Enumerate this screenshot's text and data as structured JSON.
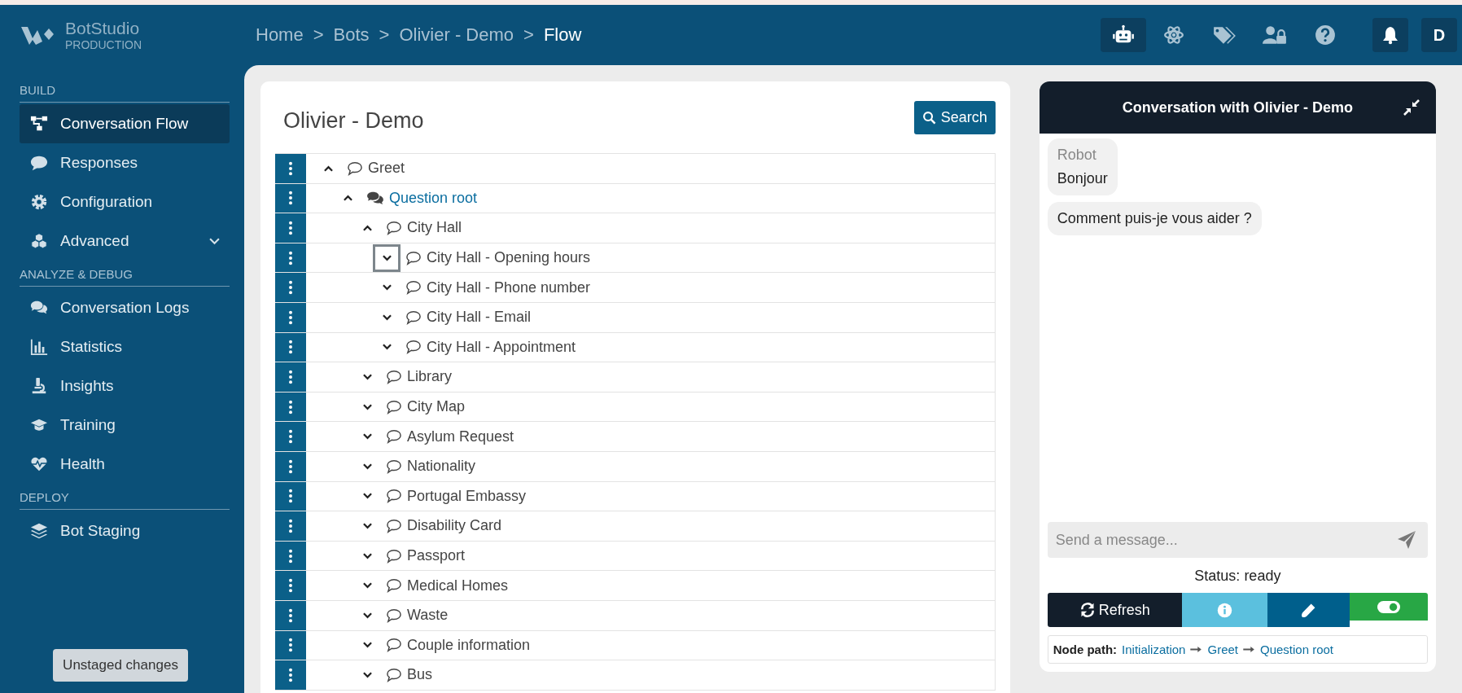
{
  "brand": {
    "name": "BotStudio",
    "environment": "PRODUCTION"
  },
  "breadcrumb": [
    {
      "label": "Home",
      "current": false
    },
    {
      "label": "Bots",
      "current": false
    },
    {
      "label": "Olivier - Demo",
      "current": false
    },
    {
      "label": "Flow",
      "current": true
    }
  ],
  "breadcrumb_separator": ">",
  "header_actions": [
    {
      "kind": "robot",
      "selected": true
    },
    {
      "kind": "atom",
      "selected": false
    },
    {
      "kind": "tags",
      "selected": false
    },
    {
      "kind": "user-lock",
      "selected": false
    },
    {
      "kind": "help",
      "selected": false
    }
  ],
  "notifications": {
    "kind": "bell"
  },
  "user": {
    "initial": "D"
  },
  "sidebar": {
    "sections": [
      {
        "title": "BUILD",
        "items": [
          {
            "label": "Conversation Flow",
            "kind": "flow",
            "selected": true
          },
          {
            "label": "Responses",
            "kind": "comment",
            "selected": false
          },
          {
            "label": "Configuration",
            "kind": "gear",
            "selected": false
          },
          {
            "label": "Advanced",
            "kind": "cubes",
            "selected": false,
            "expanded": false
          }
        ]
      },
      {
        "title": "ANALYZE & DEBUG",
        "items": [
          {
            "label": "Conversation Logs",
            "kind": "comments",
            "selected": false
          },
          {
            "label": "Statistics",
            "kind": "chart",
            "selected": false
          },
          {
            "label": "Insights",
            "kind": "microscope",
            "selected": false
          },
          {
            "label": "Training",
            "kind": "cap",
            "selected": false
          },
          {
            "label": "Health",
            "kind": "heart",
            "selected": false
          }
        ]
      },
      {
        "title": "DEPLOY",
        "items": [
          {
            "label": "Bot Staging",
            "kind": "layers",
            "selected": false
          }
        ]
      }
    ],
    "footer_button": "Unstaged changes"
  },
  "flow": {
    "title": "Olivier - Demo",
    "search_button": "Search",
    "tree": [
      {
        "label": "Greet",
        "kind": "message",
        "expanded": true,
        "focused": false,
        "children": [
          {
            "label": "Question root",
            "kind": "question",
            "expanded": true,
            "focused": false,
            "children": [
              {
                "label": "City Hall",
                "kind": "message",
                "expanded": true,
                "focused": false,
                "children": [
                  {
                    "label": "City Hall - Opening hours",
                    "kind": "message",
                    "expanded": false,
                    "focused": true
                  },
                  {
                    "label": "City Hall - Phone number",
                    "kind": "message",
                    "expanded": false,
                    "focused": false
                  },
                  {
                    "label": "City Hall - Email",
                    "kind": "message",
                    "expanded": false,
                    "focused": false
                  },
                  {
                    "label": "City Hall - Appointment",
                    "kind": "message",
                    "expanded": false,
                    "focused": false
                  }
                ]
              },
              {
                "label": "Library",
                "kind": "message",
                "expanded": false,
                "focused": false
              },
              {
                "label": "City Map",
                "kind": "message",
                "expanded": false,
                "focused": false
              },
              {
                "label": "Asylum Request",
                "kind": "message",
                "expanded": false,
                "focused": false
              },
              {
                "label": "Nationality",
                "kind": "message",
                "expanded": false,
                "focused": false
              },
              {
                "label": "Portugal Embassy",
                "kind": "message",
                "expanded": false,
                "focused": false
              },
              {
                "label": "Disability Card",
                "kind": "message",
                "expanded": false,
                "focused": false
              },
              {
                "label": "Passport",
                "kind": "message",
                "expanded": false,
                "focused": false
              },
              {
                "label": "Medical Homes",
                "kind": "message",
                "expanded": false,
                "focused": false
              },
              {
                "label": "Waste",
                "kind": "message",
                "expanded": false,
                "focused": false
              },
              {
                "label": "Couple information",
                "kind": "message",
                "expanded": false,
                "focused": false
              },
              {
                "label": "Bus",
                "kind": "message",
                "expanded": false,
                "focused": false
              }
            ]
          }
        ]
      }
    ]
  },
  "chat": {
    "title": "Conversation with Olivier - Demo",
    "messages": [
      {
        "sender": "Robot",
        "text": "Bonjour"
      },
      {
        "text": "Comment puis-je vous aider ?"
      }
    ],
    "input": {
      "placeholder": "Send a message..."
    },
    "status": "Status: ready",
    "actions": [
      {
        "kind": "refresh",
        "label": "Refresh"
      },
      {
        "kind": "info"
      },
      {
        "kind": "edit"
      },
      {
        "kind": "toggle"
      }
    ],
    "node_path": {
      "label": "Node path:",
      "steps": [
        "Initialization",
        "Greet",
        "Question root"
      ]
    }
  }
}
